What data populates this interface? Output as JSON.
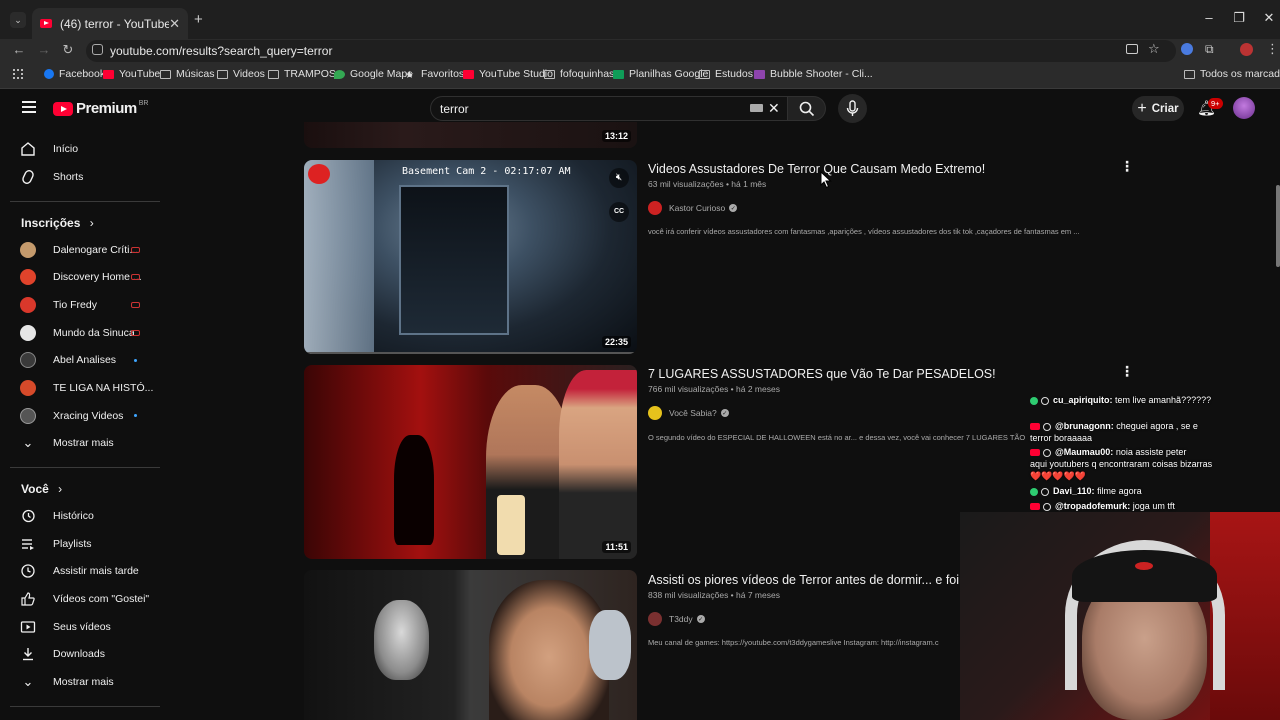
{
  "browser": {
    "tab_title": "(46) terror - YouTube",
    "url": "youtube.com/results?search_query=terror",
    "bookmarks": [
      {
        "label": "Facebook",
        "icon": "facebook-icon"
      },
      {
        "label": "YouTube",
        "icon": "youtube-icon"
      },
      {
        "label": "Músicas",
        "icon": "folder-icon"
      },
      {
        "label": "Videos",
        "icon": "folder-icon"
      },
      {
        "label": "TRAMPOS",
        "icon": "folder-icon"
      },
      {
        "label": "Google Maps",
        "icon": "maps-icon"
      },
      {
        "label": "Favoritos",
        "icon": "star-icon"
      },
      {
        "label": "YouTube Studio",
        "icon": "youtube-studio-icon"
      },
      {
        "label": "fofoquinhas",
        "icon": "folder-icon"
      },
      {
        "label": "Planilhas Google",
        "icon": "sheets-icon"
      },
      {
        "label": "Estudos",
        "icon": "folder-icon"
      },
      {
        "label": "Bubble Shooter - Cli...",
        "icon": "game-icon"
      }
    ],
    "all_bookmarks": "Todos os marcadores"
  },
  "masthead": {
    "logo_text": "Premium",
    "region": "BR",
    "search_value": "terror",
    "create_label": "Criar",
    "notifications_badge": "9+"
  },
  "sidebar": {
    "main": [
      {
        "label": "Início",
        "icon": "home-icon"
      },
      {
        "label": "Shorts",
        "icon": "shorts-icon"
      }
    ],
    "subscriptions_title": "Inscrições",
    "subscriptions": [
      {
        "label": "Dalenogare Críti...",
        "status": "live",
        "color": "#c49a6c"
      },
      {
        "label": "Discovery Home ...",
        "status": "live",
        "color": "#e0432b"
      },
      {
        "label": "Tio Fredy",
        "status": "live",
        "color": "#d9382b"
      },
      {
        "label": "Mundo da Sinuca",
        "status": "live",
        "color": "#e6e6e6"
      },
      {
        "label": "Abel Analises",
        "status": "new",
        "color": "#3a3a3a"
      },
      {
        "label": "TE LIGA NA HISTÓ...",
        "status": "none",
        "color": "#d64a2a"
      },
      {
        "label": "Xracing Videos",
        "status": "new",
        "color": "#555555"
      }
    ],
    "show_more": "Mostrar mais",
    "you_title": "Você",
    "you_items": [
      {
        "label": "Histórico",
        "icon": "history-icon"
      },
      {
        "label": "Playlists",
        "icon": "playlists-icon"
      },
      {
        "label": "Assistir mais tarde",
        "icon": "watch-later-icon"
      },
      {
        "label": "Vídeos com \"Gostei\"",
        "icon": "like-icon"
      },
      {
        "label": "Seus vídeos",
        "icon": "your-videos-icon"
      },
      {
        "label": "Downloads",
        "icon": "download-icon"
      },
      {
        "label": "Mostrar mais",
        "icon": "chevron-down-icon"
      }
    ]
  },
  "results": {
    "previous_duration": "13:12",
    "videos": [
      {
        "title": "Videos Assustadores De Terror Que Causam Medo Extremo!",
        "meta": "63 mil visualizações • há 1 mês",
        "channel": "Kastor Curioso",
        "description": "você irá conferir vídeos assustadores com fantasmas ,aparições , vídeos assustadores dos tik tok ,caçadores de fantasmas em ...",
        "duration": "22:35",
        "overlay_text": "Basement Cam 2 - 02:17:07 AM"
      },
      {
        "title": "7 LUGARES ASSUSTADORES que Vão Te Dar PESADELOS!",
        "meta": "766 mil visualizações • há 2 meses",
        "channel": "Você Sabia?",
        "description": "O segundo vídeo do ESPECIAL DE HALLOWEEN está no ar... e dessa vez, você vai conhecer 7 LUGARES TÃO",
        "duration": "11:51"
      },
      {
        "title": "Assisti os piores vídeos de Terror antes de dormir... e foi um",
        "meta": "838 mil visualizações • há 7 meses",
        "channel": "T3ddy",
        "description": "Meu canal de games: https://youtube.com/t3ddygameslive Instagram: http://instagram.c"
      }
    ]
  },
  "chat": [
    {
      "user": "cu_apiriquito:",
      "text": "tem live amanhã??????",
      "cont": "",
      "badge": "member"
    },
    {
      "user": "@brunagonn:",
      "text": "cheguei agora , se e",
      "cont": "terror boraaaaa",
      "badge": "youtube"
    },
    {
      "user": "@Maumau00:",
      "text": "noia assiste peter",
      "cont": "aqui youtubers q encontraram coisas bizarras ❤️❤️❤️❤️❤️",
      "badge": "youtube"
    },
    {
      "user": "Davi_110:",
      "text": "filme agora",
      "cont": "",
      "badge": "member"
    },
    {
      "user": "@tropadofemurk:",
      "text": "joga um tft",
      "cont": "",
      "badge": "youtube"
    }
  ]
}
